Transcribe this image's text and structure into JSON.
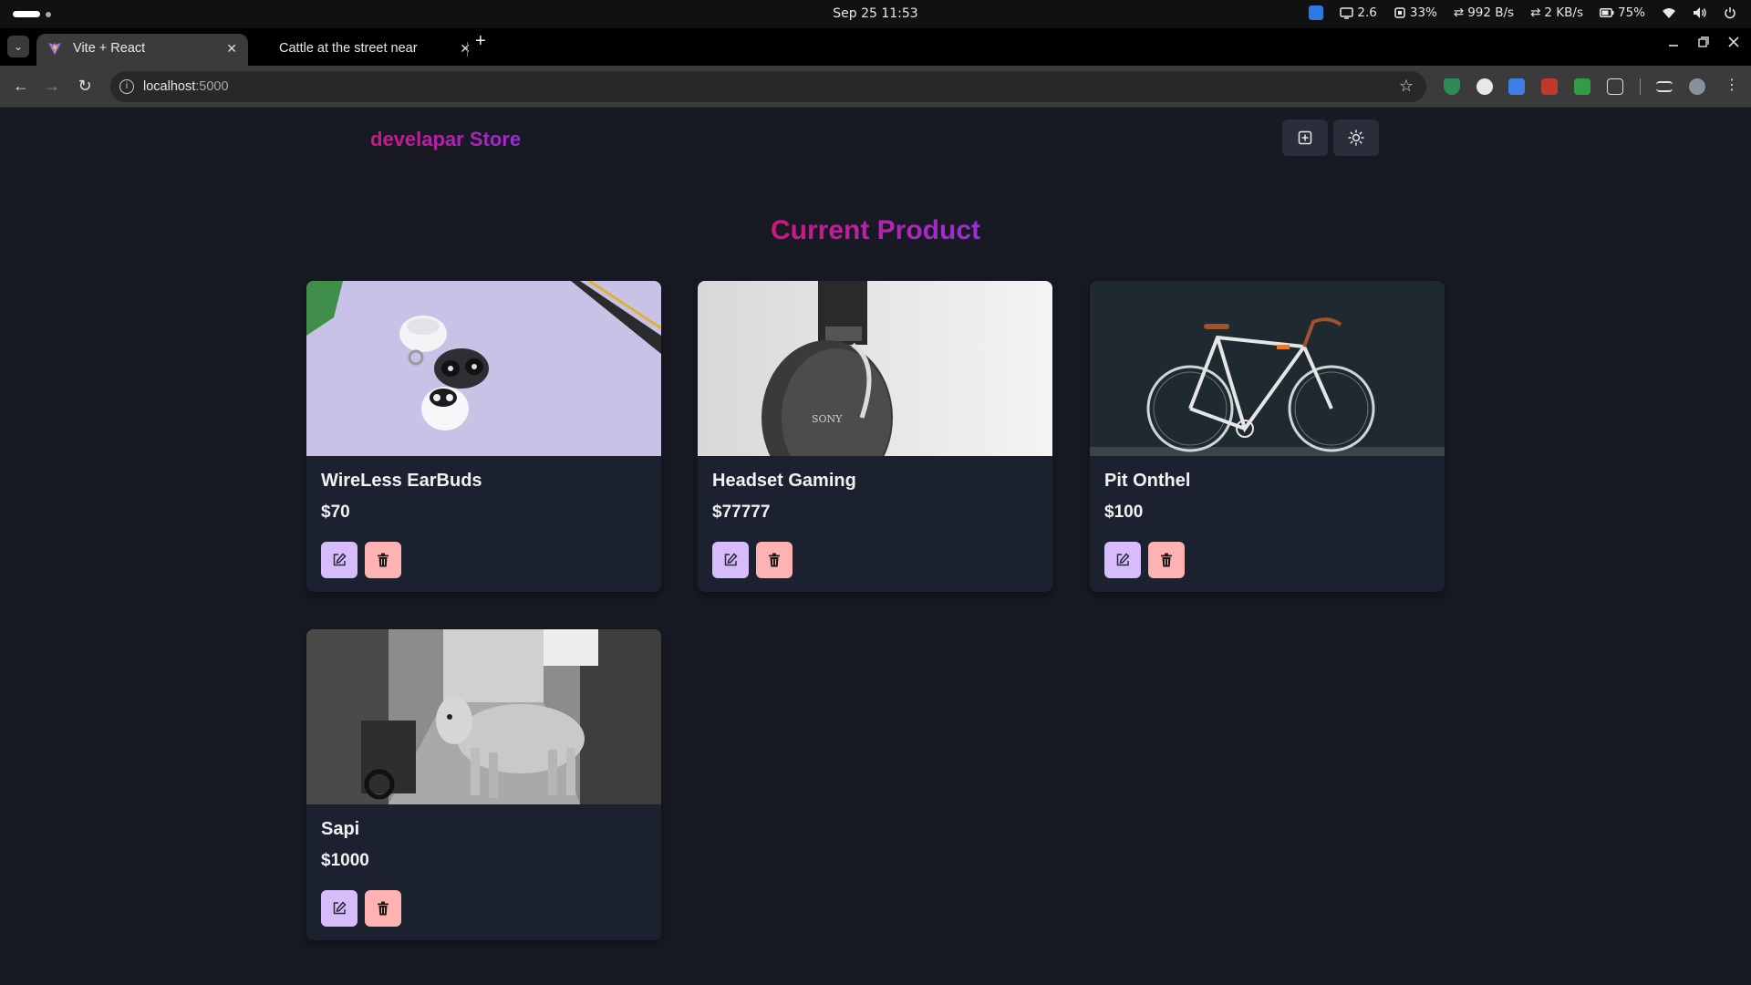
{
  "os": {
    "clock": "Sep 25  11:53",
    "tray": {
      "display": "2.6",
      "cpu": "33%",
      "down": "992 B/s",
      "up": "2 KB/s",
      "battery": "75%"
    }
  },
  "browser": {
    "tabs": [
      {
        "label": "Vite + React"
      },
      {
        "label": "Cattle at the street near"
      }
    ],
    "url_host": "localhost",
    "url_port": ":5000"
  },
  "app": {
    "brand": "develapar Store",
    "page_title": "Current Product",
    "products": [
      {
        "name": "WireLess EarBuds",
        "price": "$70"
      },
      {
        "name": "Headset Gaming",
        "price": "$77777"
      },
      {
        "name": "Pit Onthel",
        "price": "$100"
      },
      {
        "name": "Sapi",
        "price": "$1000"
      }
    ],
    "icons": {
      "create": "plus-square-icon",
      "theme": "sun-icon",
      "edit": "edit-icon",
      "delete": "trash-icon"
    }
  },
  "colors": {
    "background": "#171923",
    "card": "#1c2130",
    "edit_button": "#d6bcfa",
    "delete_button": "#feb2b2",
    "brand_gradient_start": "#d01684",
    "brand_gradient_end": "#9b2bd6"
  }
}
